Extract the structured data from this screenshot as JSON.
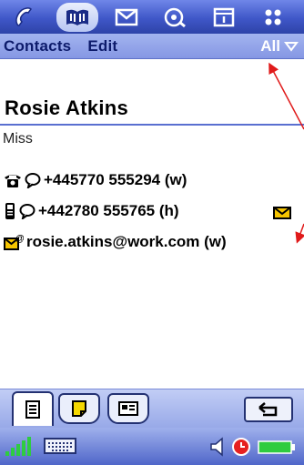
{
  "app": {
    "tabs": [
      {
        "name": "phone-icon"
      },
      {
        "name": "contacts-book-icon",
        "active": true
      },
      {
        "name": "messages-icon"
      },
      {
        "name": "web-icon"
      },
      {
        "name": "calendar-icon"
      },
      {
        "name": "apps-grid-icon"
      }
    ]
  },
  "menubar": {
    "contacts_label": "Contacts",
    "edit_label": "Edit",
    "filter_label": "All"
  },
  "contact": {
    "name": "Rosie Atkins",
    "title": "Miss",
    "phone_work": "+445770 555294 (w)",
    "phone_home": "+442780 555765 (h)",
    "email": "rosie.atkins@work.com (w)"
  },
  "bottom_tabs": [
    {
      "name": "details-tab-icon",
      "active": true
    },
    {
      "name": "notes-tab-icon"
    },
    {
      "name": "card-tab-icon"
    }
  ],
  "status": {
    "signal_icon": "signal-strength-icon",
    "keyboard_icon": "keyboard-icon",
    "volume_icon": "speaker-icon",
    "alarm_icon": "clock-icon",
    "battery_icon": "battery-icon"
  },
  "colors": {
    "bar_blue": "#3f57c8",
    "menu_blue": "#8597e4",
    "accent_text": "#0d1b6b",
    "annotation_red": "#e01a1a"
  }
}
